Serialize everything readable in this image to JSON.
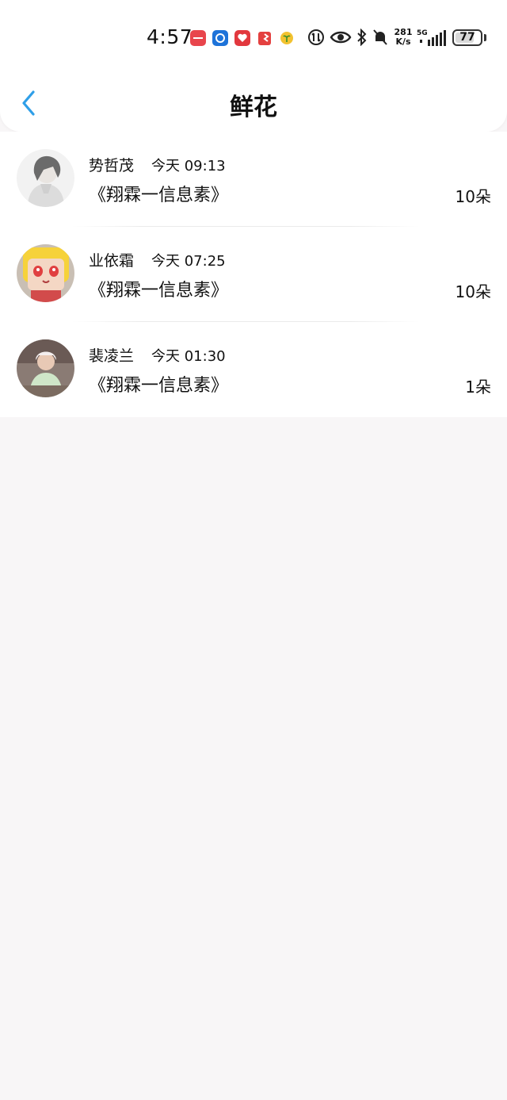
{
  "status_bar": {
    "time": "4:57",
    "speed_value": "281",
    "speed_unit": "K/s",
    "network": "5G",
    "battery": "77",
    "battery_level": 0.77
  },
  "nav": {
    "title": "鲜花"
  },
  "colors": {
    "accent": "#2f9fe8",
    "background": "#f8f6f7"
  },
  "records": [
    {
      "name": "势哲茂",
      "time": "今天 09:13",
      "book": "《翔霖一信息素》",
      "count": "10朵"
    },
    {
      "name": "业依霜",
      "time": "今天 07:25",
      "book": "《翔霖一信息素》",
      "count": "10朵"
    },
    {
      "name": "裴凌兰",
      "time": "今天 01:30",
      "book": "《翔霖一信息素》",
      "count": "1朵"
    }
  ]
}
